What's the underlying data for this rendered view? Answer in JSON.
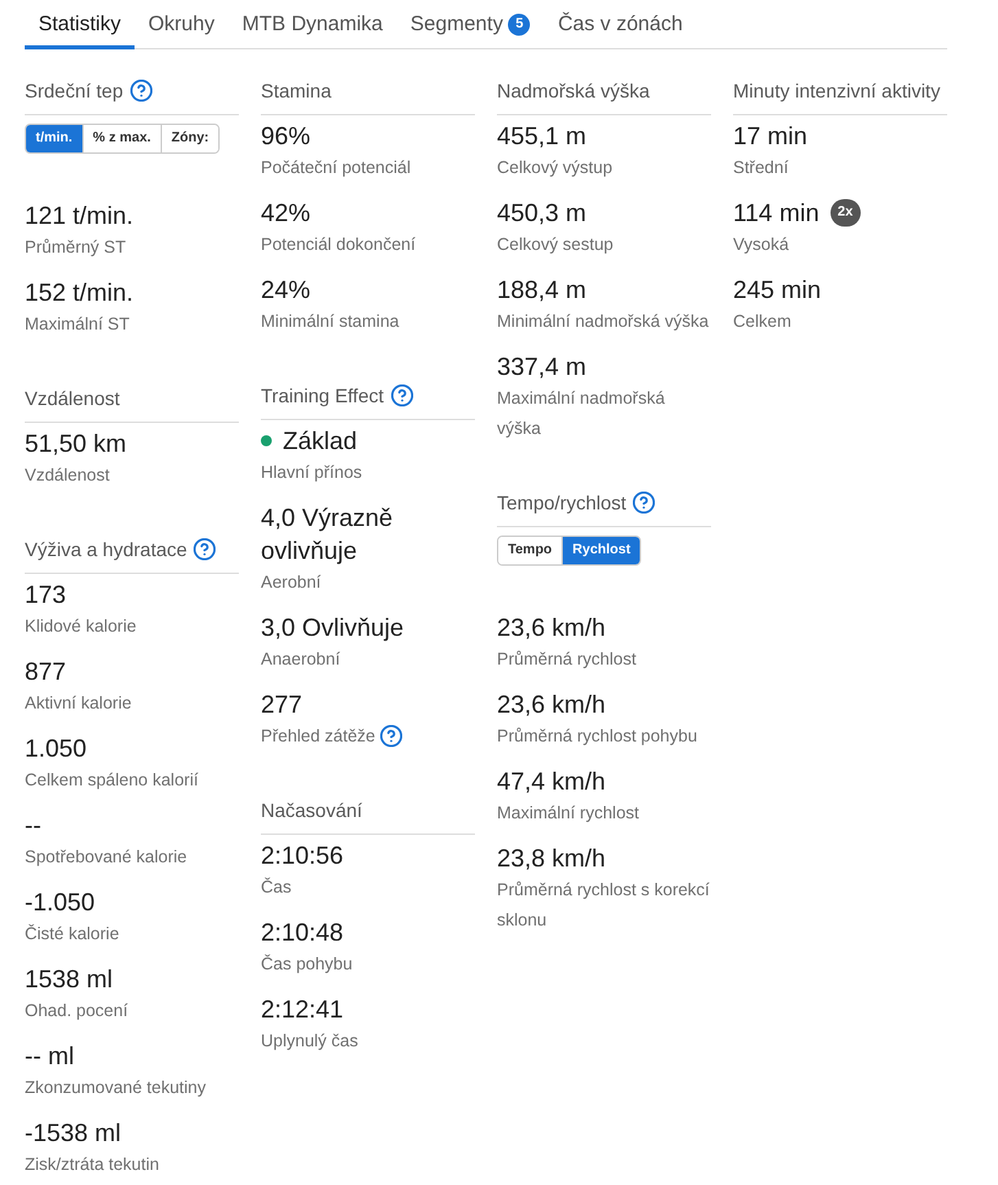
{
  "tabs": [
    {
      "label": "Statistiky",
      "selected": true
    },
    {
      "label": "Okruhy",
      "selected": false
    },
    {
      "label": "MTB Dynamika",
      "selected": false
    },
    {
      "label": "Segmenty",
      "selected": false,
      "badge": "5"
    },
    {
      "label": "Čas v zónách",
      "selected": false
    }
  ],
  "columns": [
    {
      "sections": [
        {
          "title": "Srdeční tep",
          "help": true,
          "toggle": [
            {
              "label": "t/min.",
              "selected": true
            },
            {
              "label": "% z max.",
              "selected": false
            },
            {
              "label": "Zóny:",
              "selected": false
            }
          ],
          "stats": [
            {
              "value": "121 t/min.",
              "label": "Průměrný ST"
            },
            {
              "value": "152 t/min.",
              "label": "Maximální ST"
            }
          ]
        },
        {
          "title": "Vzdálenost",
          "stats": [
            {
              "value": "51,50 km",
              "label": "Vzdálenost"
            }
          ]
        },
        {
          "title": "Výživa a hydratace",
          "help": true,
          "stats": [
            {
              "value": "173",
              "label": "Klidové kalorie"
            },
            {
              "value": "877",
              "label": "Aktivní kalorie"
            },
            {
              "value": "1.050",
              "label": "Celkem spáleno kalorií"
            },
            {
              "value": "--",
              "label": "Spotřebované kalorie"
            },
            {
              "value": "-1.050",
              "label": "Čisté kalorie"
            },
            {
              "value": "1538 ml",
              "label": "Ohad. pocení"
            },
            {
              "value": "-- ml",
              "label": "Zkonzumované tekutiny"
            },
            {
              "value": "-1538 ml",
              "label": "Zisk/ztráta tekutin"
            }
          ]
        }
      ]
    },
    {
      "sections": [
        {
          "title": "Stamina",
          "stats": [
            {
              "value": "96%",
              "label": "Počáteční potenciál"
            },
            {
              "value": "42%",
              "label": "Potenciál dokončení"
            },
            {
              "value": "24%",
              "label": "Minimální stamina"
            }
          ]
        },
        {
          "title": "Training Effect",
          "help": true,
          "stats": [
            {
              "value": "Základ",
              "label": "Hlavní přínos",
              "color": "#19a06e"
            },
            {
              "value": "4,0 Výrazně ovlivňuje",
              "label": "Aerobní"
            },
            {
              "value": "3,0 Ovlivňuje",
              "label": "Anaerobní"
            },
            {
              "value": "277",
              "label": "Přehled zátěže",
              "help": true
            }
          ]
        },
        {
          "title": "Načasování",
          "stats": [
            {
              "value": "2:10:56",
              "label": "Čas"
            },
            {
              "value": "2:10:48",
              "label": "Čas pohybu"
            },
            {
              "value": "2:12:41",
              "label": "Uplynulý čas"
            }
          ]
        }
      ]
    },
    {
      "sections": [
        {
          "title": "Nadmořská výška",
          "stats": [
            {
              "value": "455,1 m",
              "label": "Celkový výstup"
            },
            {
              "value": "450,3 m",
              "label": "Celkový sestup"
            },
            {
              "value": "188,4 m",
              "label": "Minimální nadmořská výška"
            },
            {
              "value": "337,4 m",
              "label": "Maximální nadmořská výška"
            }
          ]
        },
        {
          "title": "Tempo/rychlost",
          "help": true,
          "toggle": [
            {
              "label": "Tempo",
              "selected": false
            },
            {
              "label": "Rychlost",
              "selected": true
            }
          ],
          "stats": [
            {
              "value": "23,6 km/h",
              "label": "Průměrná rychlost"
            },
            {
              "value": "23,6 km/h",
              "label": "Průměrná rychlost pohybu"
            },
            {
              "value": "47,4 km/h",
              "label": "Maximální rychlost"
            },
            {
              "value": "23,8 km/h",
              "label": "Průměrná rychlost s korekcí sklonu"
            }
          ]
        }
      ]
    },
    {
      "sections": [
        {
          "title": "Minuty intenzivní aktivity",
          "stats": [
            {
              "value": "17 min",
              "label": "Střední"
            },
            {
              "value": "114 min",
              "label": "Vysoká",
              "badge": "2x"
            },
            {
              "value": "245 min",
              "label": "Celkem"
            }
          ]
        }
      ]
    }
  ]
}
